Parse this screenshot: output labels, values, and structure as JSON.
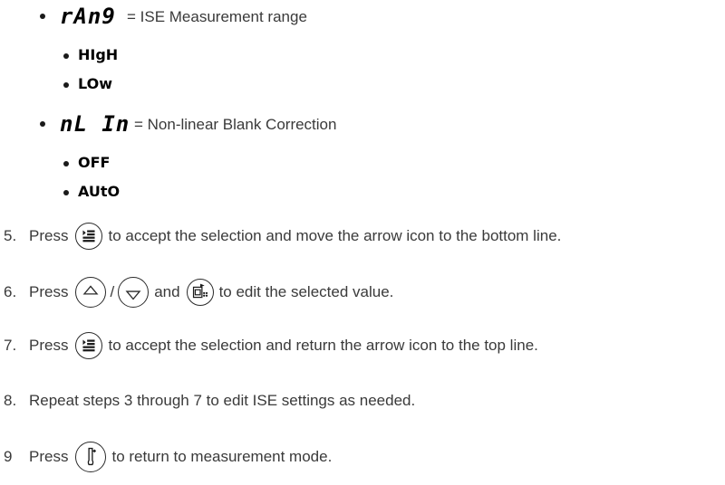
{
  "options": [
    {
      "code": "rAn9",
      "label": "= ISE Measurement range",
      "values": [
        "HIgH",
        "LOw"
      ]
    },
    {
      "code": "nL In",
      "label": "= Non-linear Blank Correction",
      "values": [
        "OFF",
        "AUtO"
      ]
    }
  ],
  "steps": [
    {
      "number": "5.",
      "before": "Press",
      "after": "to accept the selection and move the arrow icon to the bottom line."
    },
    {
      "number": "6.",
      "before": "Press",
      "slash": "/",
      "mid": "and",
      "after": "to edit the selected value."
    },
    {
      "number": "7.",
      "before": "Press",
      "after": "to accept the selection and return the arrow icon to the top line."
    },
    {
      "number": "8.",
      "text": "Repeat steps 3 through 7 to edit ISE settings as needed."
    },
    {
      "number": "9",
      "before": "Press",
      "after": "to return to measurement mode."
    }
  ],
  "icons": {
    "menu_key": "menu-list-icon",
    "up_key": "up-arrow-icon",
    "down_key": "down-arrow-icon",
    "cal_key": "calibration-icon",
    "measure_key": "probe-icon"
  }
}
